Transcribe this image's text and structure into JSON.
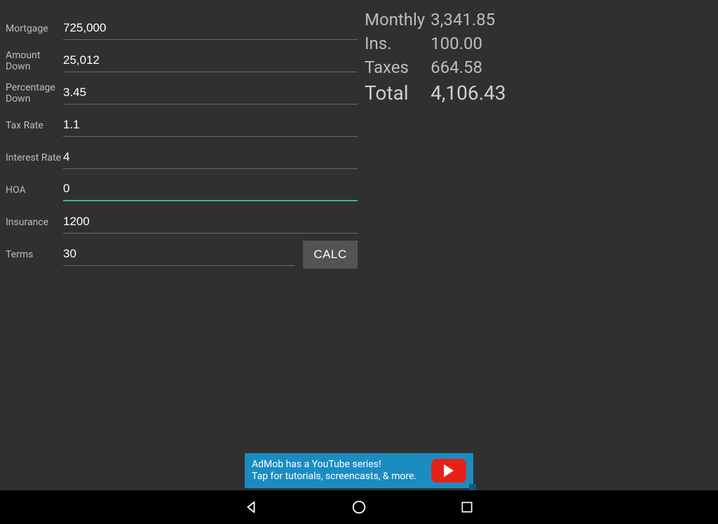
{
  "form": {
    "mortgage": {
      "label": "Mortgage",
      "value": "725,000"
    },
    "amount_down": {
      "label": "Amount\n Down",
      "value": "25,012"
    },
    "percent_down": {
      "label": "Percentage\n Down",
      "value": "3.45"
    },
    "tax_rate": {
      "label": "Tax Rate",
      "value": "1.1"
    },
    "interest_rate": {
      "label": "Interest Rate",
      "value": "4"
    },
    "hoa": {
      "label": "HOA",
      "value": "0",
      "focused": true
    },
    "insurance": {
      "label": "Insurance",
      "value": "1200"
    },
    "terms": {
      "label": "Terms",
      "value": "30"
    }
  },
  "calc_button": "CALC",
  "results": {
    "monthly": {
      "label": "Monthly",
      "value": "3,341.85"
    },
    "ins": {
      "label": "Ins.",
      "value": "100.00"
    },
    "taxes": {
      "label": "Taxes",
      "value": "664.58"
    },
    "total": {
      "label": "Total",
      "value": "4,106.43"
    }
  },
  "ad": {
    "line1": "AdMob has a YouTube series!",
    "line2": "Tap for tutorials, screencasts, & more."
  },
  "colors": {
    "background": "#303030",
    "accent": "#33b8a4",
    "ad_bg": "#1b8cc2",
    "youtube_red": "#e62117"
  }
}
